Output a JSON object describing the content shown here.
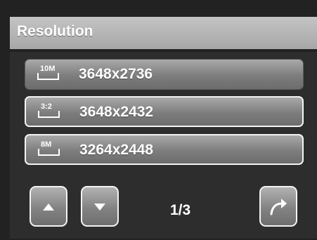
{
  "header": {
    "title": "Resolution"
  },
  "options": [
    {
      "icon_text": "10M",
      "icon": "resolution-10m-icon",
      "label": "3648x2736"
    },
    {
      "icon_text": "3:2",
      "icon": "resolution-3-2-icon",
      "label": "3648x2432"
    },
    {
      "icon_text": "8M",
      "icon": "resolution-8m-icon",
      "label": "3264x2448"
    }
  ],
  "pager": {
    "indicator": "1/3"
  },
  "colors": {
    "background": "#222222",
    "header": "#b5b5b5",
    "button_border": "#f3f3f3",
    "text": "#ffffff"
  }
}
